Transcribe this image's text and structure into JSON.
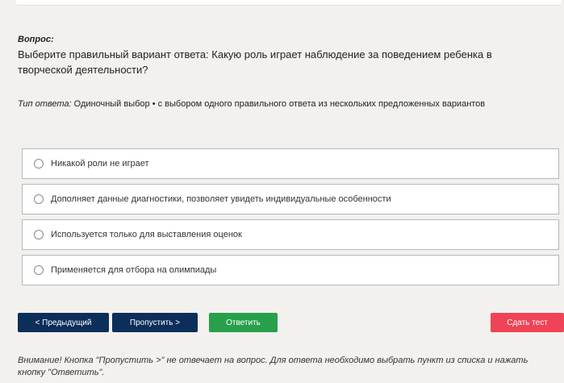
{
  "question": {
    "label": "Вопрос:",
    "text": "Выберите правильный вариант ответа: Какую роль играет наблюдение за поведением ребенка в творческой деятельности?"
  },
  "answer_type": {
    "label": "Тип ответа:",
    "value": " Одиночный выбор • с выбором одного правильного ответа из нескольких предложенных вариантов"
  },
  "options": [
    {
      "label": "Никакой роли не играет",
      "selected": false
    },
    {
      "label": "Дополняет данные диагностики, позволяет увидеть индивидуальные особенности",
      "selected": false
    },
    {
      "label": "Используется только для выставления оценок",
      "selected": false
    },
    {
      "label": "Применяется для отбора на олимпиады",
      "selected": false
    }
  ],
  "buttons": {
    "prev": "< Предыдущий",
    "skip": "Пропустить >",
    "answer": "Ответить",
    "finish": "Сдать тест"
  },
  "notice": "Внимание! Кнопка \"Пропустить >\" не отвечает на вопрос. Для ответа необходимо выбрать пункт из списка и нажать кнопку \"Ответить\".",
  "colors": {
    "page_bg": "#f2f1ee",
    "nav_button": "#0b2e5b",
    "answer_button": "#28a04b",
    "finish_button": "#ef4455"
  }
}
